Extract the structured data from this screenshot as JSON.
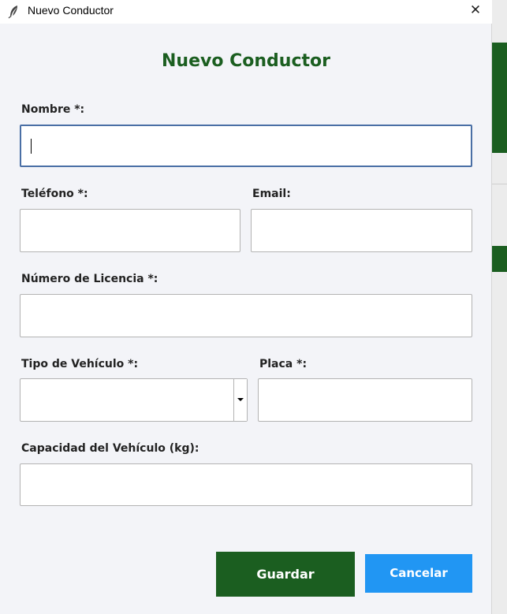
{
  "window": {
    "title": "Nuevo Conductor",
    "close_glyph": "✕",
    "icon": "feather-icon"
  },
  "form": {
    "heading": "Nuevo Conductor",
    "nombre_label": "Nombre *:",
    "nombre_value": "",
    "telefono_label": "Teléfono *:",
    "telefono_value": "",
    "email_label": "Email:",
    "email_value": "",
    "licencia_label": "Número de Licencia *:",
    "licencia_value": "",
    "tipo_vehiculo_label": "Tipo de Vehículo *:",
    "tipo_vehiculo_value": "",
    "placa_label": "Placa *:",
    "placa_value": "",
    "capacidad_label": "Capacidad del Vehículo (kg):",
    "capacidad_value": ""
  },
  "actions": {
    "save_label": "Guardar",
    "cancel_label": "Cancelar"
  },
  "colors": {
    "heading": "#1b5e20",
    "save_button": "#1b5e20",
    "cancel_button": "#2196f3",
    "focus_border": "#4a6fa5"
  }
}
